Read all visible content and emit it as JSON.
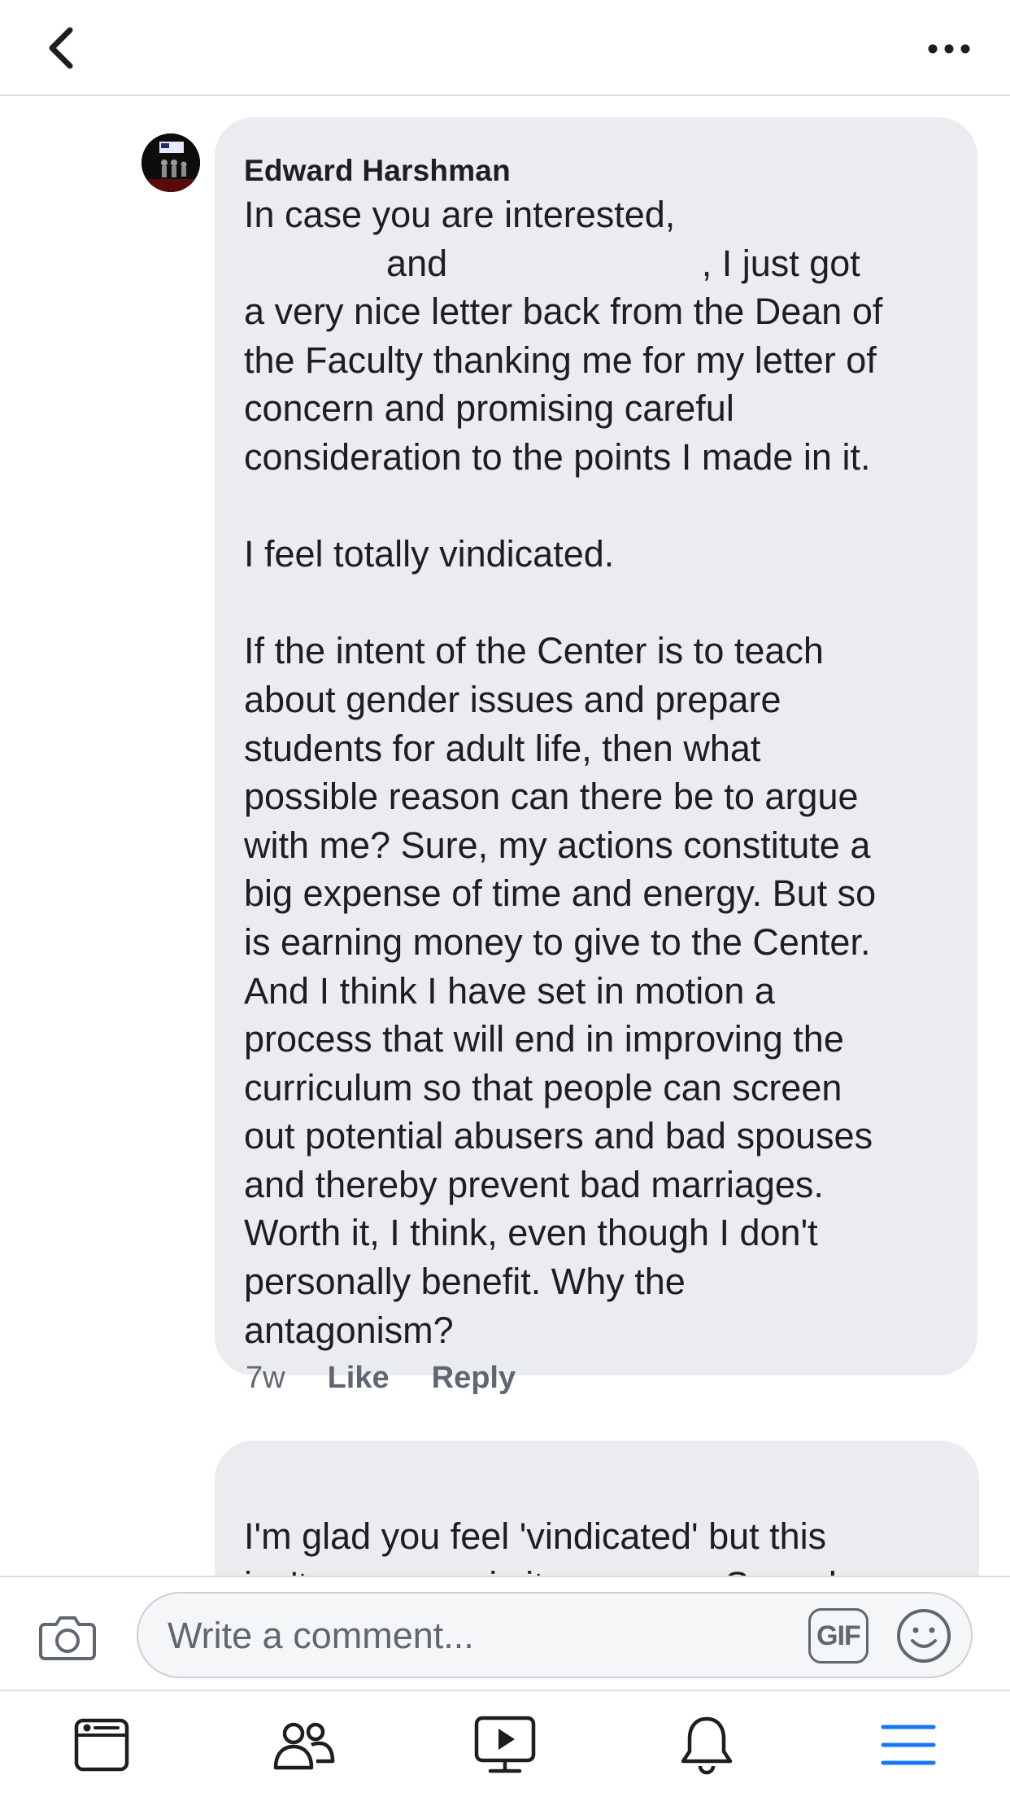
{
  "header": {
    "back_icon": "chevron-left-icon",
    "more_icon": "ellipsis-icon"
  },
  "comment": {
    "author": "Edward Harshman",
    "body": "In case you are interested,\n              and                         , I just got\na very nice letter back from the Dean of\nthe Faculty thanking me for my letter of\nconcern and promising careful\nconsideration to the points I made in it.\n\nI feel totally vindicated.\n\nIf the intent of the Center is to teach\nabout gender issues and prepare\nstudents for adult life, then what\npossible reason can there be to argue\nwith me? Sure, my actions constitute a\nbig expense of time and energy. But so\nis earning money to give to the Center.\nAnd I think I have set in motion a\nprocess that will end in improving the\ncurriculum so that people can screen\nout potential abusers and bad spouses\nand thereby prevent bad marriages.\nWorth it, I think, even though I don't\npersonally benefit. Why the\nantagonism?",
    "time": "7w",
    "like_label": "Like",
    "reply_label": "Reply"
  },
  "reply": {
    "body": "I'm glad you feel 'vindicated' but this\nisn't a war, nor is it zero sum. Sexual"
  },
  "composer": {
    "placeholder": "Write a comment...",
    "gif_label": "GIF",
    "camera_icon": "camera-icon",
    "emoji_icon": "smiley-icon"
  },
  "tabbar": {
    "items": [
      "news-feed-icon",
      "friends-icon",
      "watch-icon",
      "notifications-icon",
      "menu-icon"
    ],
    "active_color": "#1877f2",
    "inactive_color": "#1c1e21"
  }
}
